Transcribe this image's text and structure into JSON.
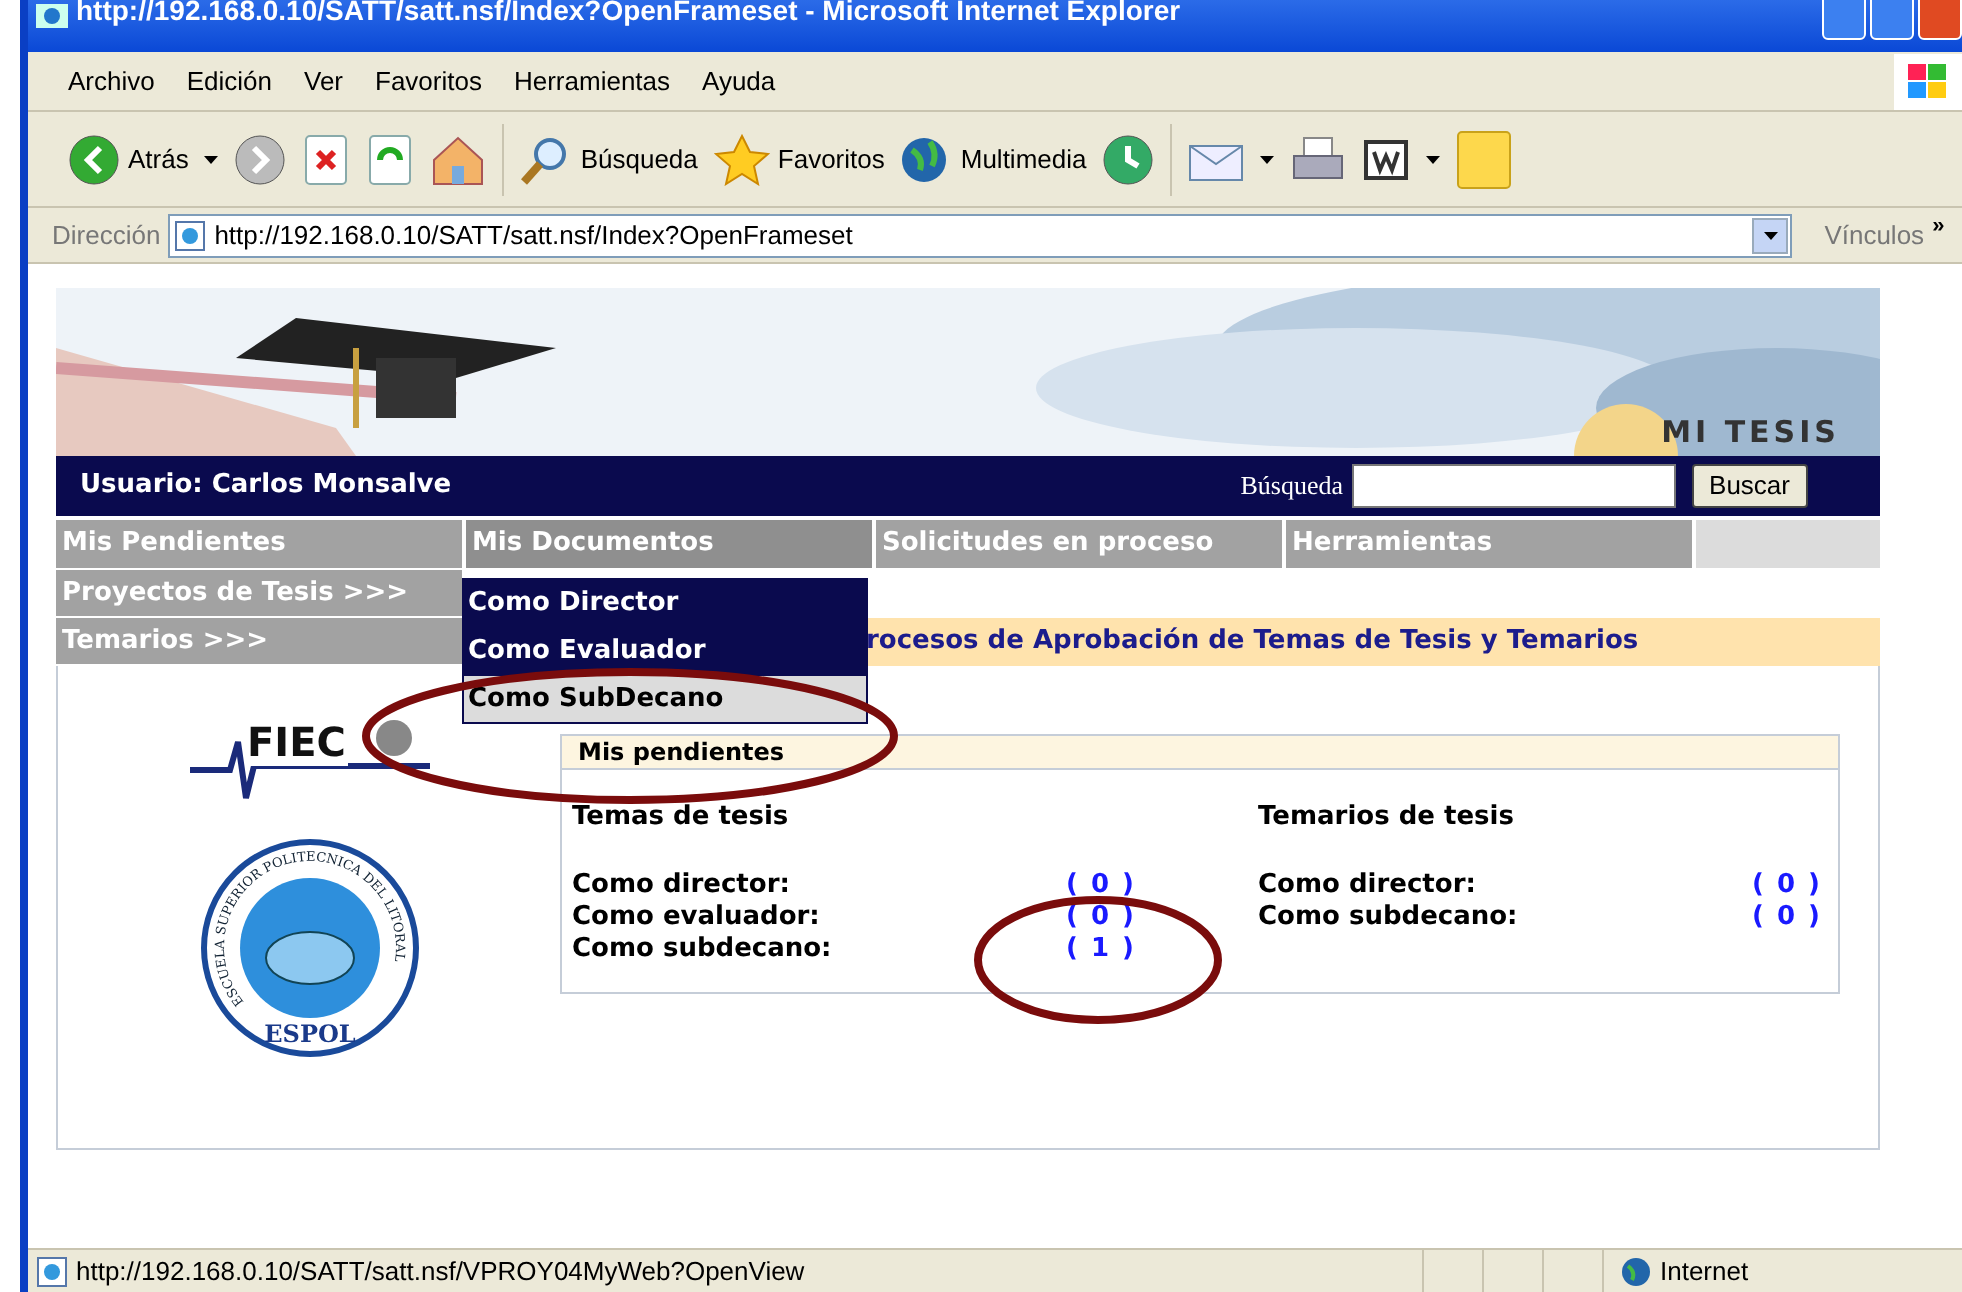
{
  "window": {
    "title": "http://192.168.0.10/SATT/satt.nsf/Index?OpenFrameset - Microsoft Internet Explorer"
  },
  "menu": [
    "Archivo",
    "Edición",
    "Ver",
    "Favoritos",
    "Herramientas",
    "Ayuda"
  ],
  "toolbar": {
    "back": "Atrás",
    "search": "Búsqueda",
    "favorites": "Favoritos",
    "media": "Multimedia"
  },
  "address": {
    "label": "Dirección",
    "url": "http://192.168.0.10/SATT/satt.nsf/Index?OpenFrameset",
    "links": "Vínculos",
    "more": "»"
  },
  "page": {
    "brand": "MI TESIS",
    "user": "Usuario: Carlos Monsalve",
    "search_label": "Búsqueda",
    "search_button": "Buscar",
    "tabs": [
      {
        "label": "Mis Pendientes",
        "selected": false
      },
      {
        "label": "Mis Documentos",
        "selected": true
      },
      {
        "label": "Solicitudes en proceso",
        "selected": false
      },
      {
        "label": "Herramientas",
        "selected": false
      }
    ],
    "side": [
      "Proyectos de Tesis >>>",
      "Temarios >>>"
    ],
    "dropdown": [
      {
        "label": "Como Director",
        "selected": false
      },
      {
        "label": "Como Evaluador",
        "selected": false
      },
      {
        "label": "Como SubDecano",
        "selected": true
      }
    ],
    "heading": "rocesos de Aprobación de Temas de Tesis y Temarios",
    "fiec": "FIEC",
    "seal_ring": "ESCUELA SUPERIOR POLITECNICA DEL LITORAL",
    "seal": "ESPOL",
    "pending": {
      "title": "Mis pendientes",
      "groups": [
        {
          "title": "Temas de tesis",
          "rows": [
            {
              "label": "Como director:",
              "count": "( 0 )"
            },
            {
              "label": "Como evaluador:",
              "count": "( 0 )"
            },
            {
              "label": "Como subdecano:",
              "count": "( 1 )"
            }
          ]
        },
        {
          "title": "Temarios de tesis",
          "rows": [
            {
              "label": "Como director:",
              "count": "( 0 )"
            },
            {
              "label": "Como subdecano:",
              "count": "( 0 )"
            }
          ]
        }
      ]
    }
  },
  "status": {
    "url": "http://192.168.0.10/SATT/satt.nsf/VPROY04MyWeb?OpenView",
    "zone": "Internet"
  }
}
